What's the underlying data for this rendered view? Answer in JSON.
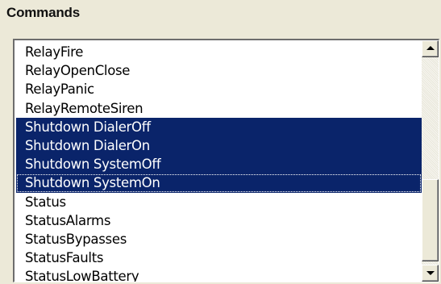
{
  "group": {
    "title": "Commands"
  },
  "commands": {
    "items": [
      {
        "label": "RelayFire",
        "selected": false
      },
      {
        "label": "RelayOpenClose",
        "selected": false
      },
      {
        "label": "RelayPanic",
        "selected": false
      },
      {
        "label": "RelayRemoteSiren",
        "selected": false
      },
      {
        "label": "Shutdown DialerOff",
        "selected": true
      },
      {
        "label": "Shutdown DialerOn",
        "selected": true
      },
      {
        "label": "Shutdown SystemOff",
        "selected": true
      },
      {
        "label": "Shutdown SystemOn",
        "selected": true,
        "focused": true
      },
      {
        "label": "Status",
        "selected": false
      },
      {
        "label": "StatusAlarms",
        "selected": false
      },
      {
        "label": "StatusBypasses",
        "selected": false
      },
      {
        "label": "StatusFaults",
        "selected": false
      },
      {
        "label": "StatusLowBattery",
        "selected": false
      }
    ]
  },
  "scrollbar": {
    "up_icon": "arrow-up-icon",
    "down_icon": "arrow-down-icon"
  },
  "colors": {
    "selection_bg": "#0a246a",
    "selection_text": "#ffffff",
    "window_bg": "#ece9d8"
  }
}
